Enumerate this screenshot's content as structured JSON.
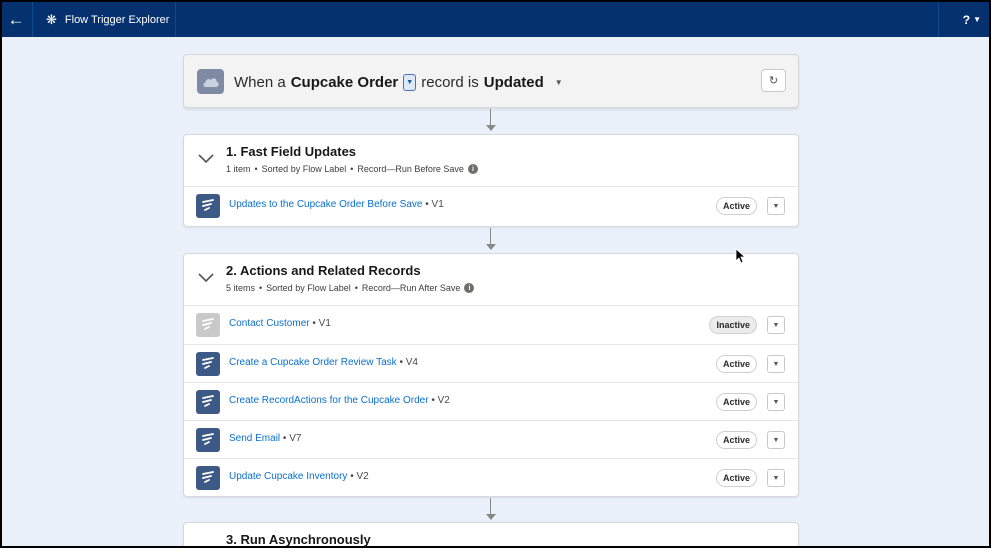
{
  "topbar": {
    "app_title": "Flow Trigger Explorer",
    "back_icon": "arrow-left-icon",
    "app_icon": "asterisk-icon",
    "help_label": "?"
  },
  "trigger": {
    "prefix": "When a",
    "object": "Cupcake Order",
    "middle": "record is",
    "event": "Updated"
  },
  "sections": [
    {
      "title": "1. Fast Field Updates",
      "count": "1 item",
      "sort": "Sorted by Flow Label",
      "run": "Record—Run Before Save",
      "flows": [
        {
          "name": "Updates to the Cupcake Order Before Save",
          "version": "V1",
          "status": "Active"
        }
      ]
    },
    {
      "title": "2. Actions and Related Records",
      "count": "5 items",
      "sort": "Sorted by Flow Label",
      "run": "Record—Run After Save",
      "flows": [
        {
          "name": "Contact Customer",
          "version": "V1",
          "status": "Inactive"
        },
        {
          "name": "Create a Cupcake Order Review Task",
          "version": "V4",
          "status": "Active"
        },
        {
          "name": "Create RecordActions for the Cupcake Order",
          "version": "V2",
          "status": "Active"
        },
        {
          "name": "Send Email",
          "version": "V7",
          "status": "Active"
        },
        {
          "name": "Update Cupcake Inventory",
          "version": "V2",
          "status": "Active"
        }
      ]
    },
    {
      "title": "3. Run Asynchronously"
    }
  ],
  "separator": "•",
  "colors": {
    "header_bg": "#05326e",
    "link": "#0b6fcc",
    "flow_icon": "#3d5a86",
    "background": "#eaf1fb"
  }
}
